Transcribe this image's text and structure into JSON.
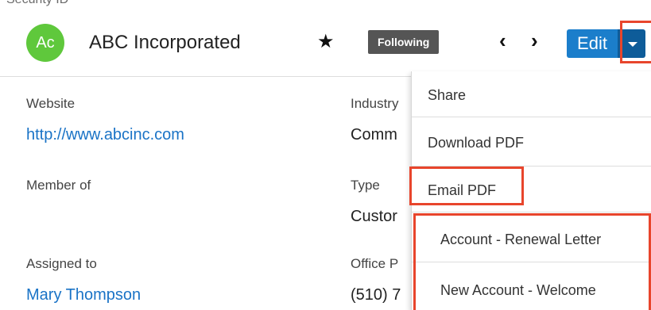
{
  "top_strip": {
    "text": "Security ID"
  },
  "header": {
    "avatar_initials": "Ac",
    "record_name": "ABC Incorporated",
    "favorite_glyph": "★",
    "following_label": "Following",
    "prev_glyph": "‹",
    "next_glyph": "›",
    "edit_label": "Edit"
  },
  "fields_left": [
    {
      "label": "Website",
      "value": "http://www.abcinc.com",
      "is_link": true
    },
    {
      "label": "Member of",
      "value": "",
      "is_link": false
    },
    {
      "label": "Assigned to",
      "value": "Mary Thompson",
      "is_link": true
    }
  ],
  "fields_right": [
    {
      "label": "Industry",
      "value": "Comm"
    },
    {
      "label": "Type",
      "value": "Custor"
    },
    {
      "label": "Office P",
      "value": "(510) 7"
    }
  ],
  "actions_menu": {
    "items": [
      "Share",
      "Download PDF",
      "Email PDF",
      "Account - Renewal Letter",
      "New Account - Welcome"
    ]
  },
  "colors": {
    "avatar": "#5fc83c",
    "edit_button": "#1b7ecb",
    "link": "#1a73c6",
    "highlight": "#e8452c"
  }
}
